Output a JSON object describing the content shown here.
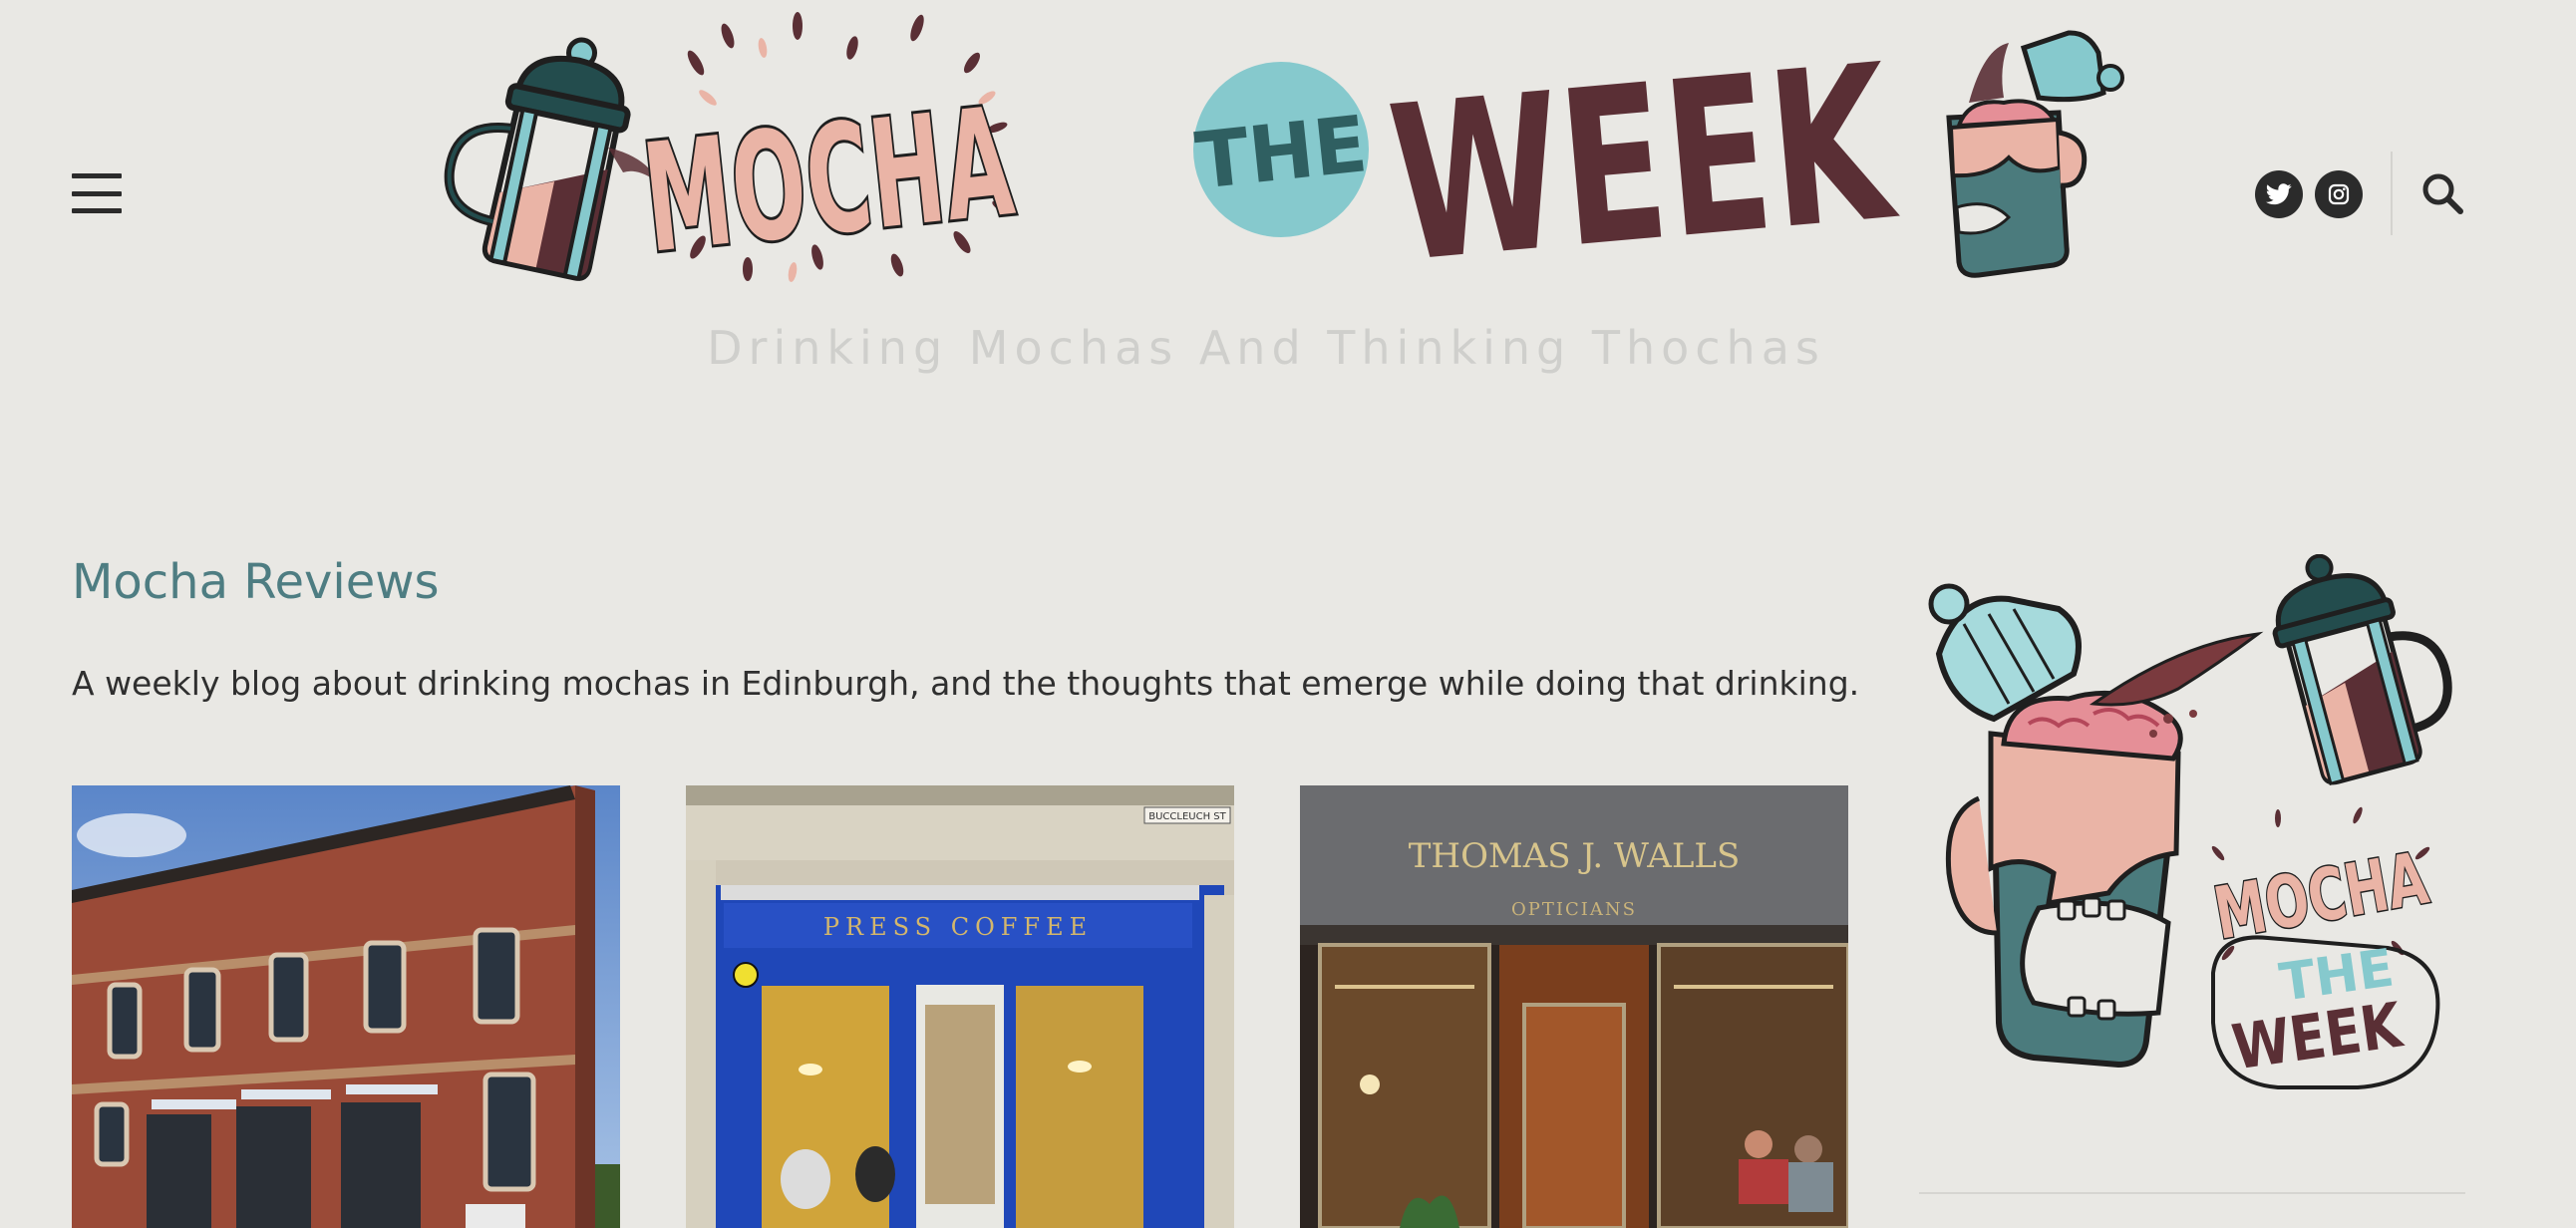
{
  "site": {
    "logo_text": {
      "mocha": "MOCHA",
      "the": "THE",
      "week": "WEEK"
    },
    "tagline": "Drinking Mochas And Thinking Thochas"
  },
  "header": {
    "menu_icon": "hamburger-menu-icon",
    "social": [
      {
        "name": "twitter",
        "icon": "twitter-bird-icon"
      },
      {
        "name": "instagram",
        "icon": "instagram-camera-icon"
      }
    ],
    "search_icon": "magnifier-icon"
  },
  "main": {
    "section_title": "Mocha Reviews",
    "intro": "A weekly blog about drinking mochas in Edinburgh, and the thoughts that emerge while doing that drinking.",
    "posts": [
      {
        "image": "brick-building-photo"
      },
      {
        "image": "press-coffee-storefront-photo",
        "sign": "PRESS COFFEE",
        "street_sign": "BUCCLEUCH ST"
      },
      {
        "image": "thomas-j-walls-storefront-photo",
        "sign": "THOMAS J. WALLS",
        "subsign": "OPTICIANS"
      }
    ]
  },
  "sidebar": {
    "logo_text": {
      "mocha": "MOCHA",
      "the": "THE",
      "week": "WEEK"
    }
  },
  "colors": {
    "background": "#e9e8e4",
    "accent_teal": "#4e7d82",
    "logo_pink": "#eab4a6",
    "logo_brown": "#5a2f35",
    "logo_teal_circle": "#86c9cd",
    "logo_dark_teal": "#234c4d"
  }
}
